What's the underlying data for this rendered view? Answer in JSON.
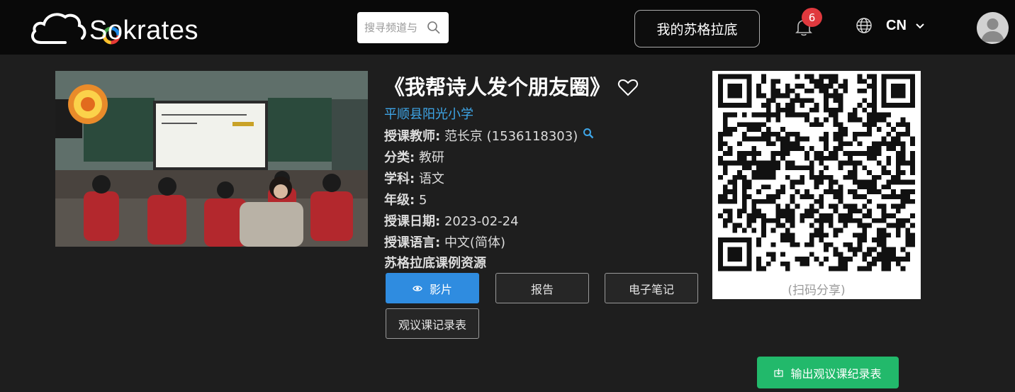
{
  "header": {
    "logo_text": "Sokrates",
    "search_placeholder": "搜寻频道与",
    "my_sokrates": "我的苏格拉底",
    "notification_count": "6",
    "language": "CN"
  },
  "lesson": {
    "title": "《我帮诗人发个朋友圈》",
    "school": "平顺县阳光小学",
    "teacher_label": "授课教师:",
    "teacher_value": "范长京 (1536118303)",
    "category_label": "分类:",
    "category_value": "教研",
    "subject_label": "学科:",
    "subject_value": "语文",
    "grade_label": "年级:",
    "grade_value": "5",
    "date_label": "授课日期:",
    "date_value": "2023-02-24",
    "language_label": "授课语言:",
    "language_value": "中文(简体)",
    "resources_title": "苏格拉底课例资源"
  },
  "resource_buttons": {
    "video": "影片",
    "report": "报告",
    "notes": "电子笔记",
    "record": "观议课记录表"
  },
  "qr": {
    "caption": "(扫码分享)"
  },
  "export_button": "输出观议课纪录表",
  "colors": {
    "accent_blue": "#2f8ce0",
    "school_link": "#3ea6e8",
    "export_green": "#22b96b",
    "badge_red": "#e0393e"
  }
}
